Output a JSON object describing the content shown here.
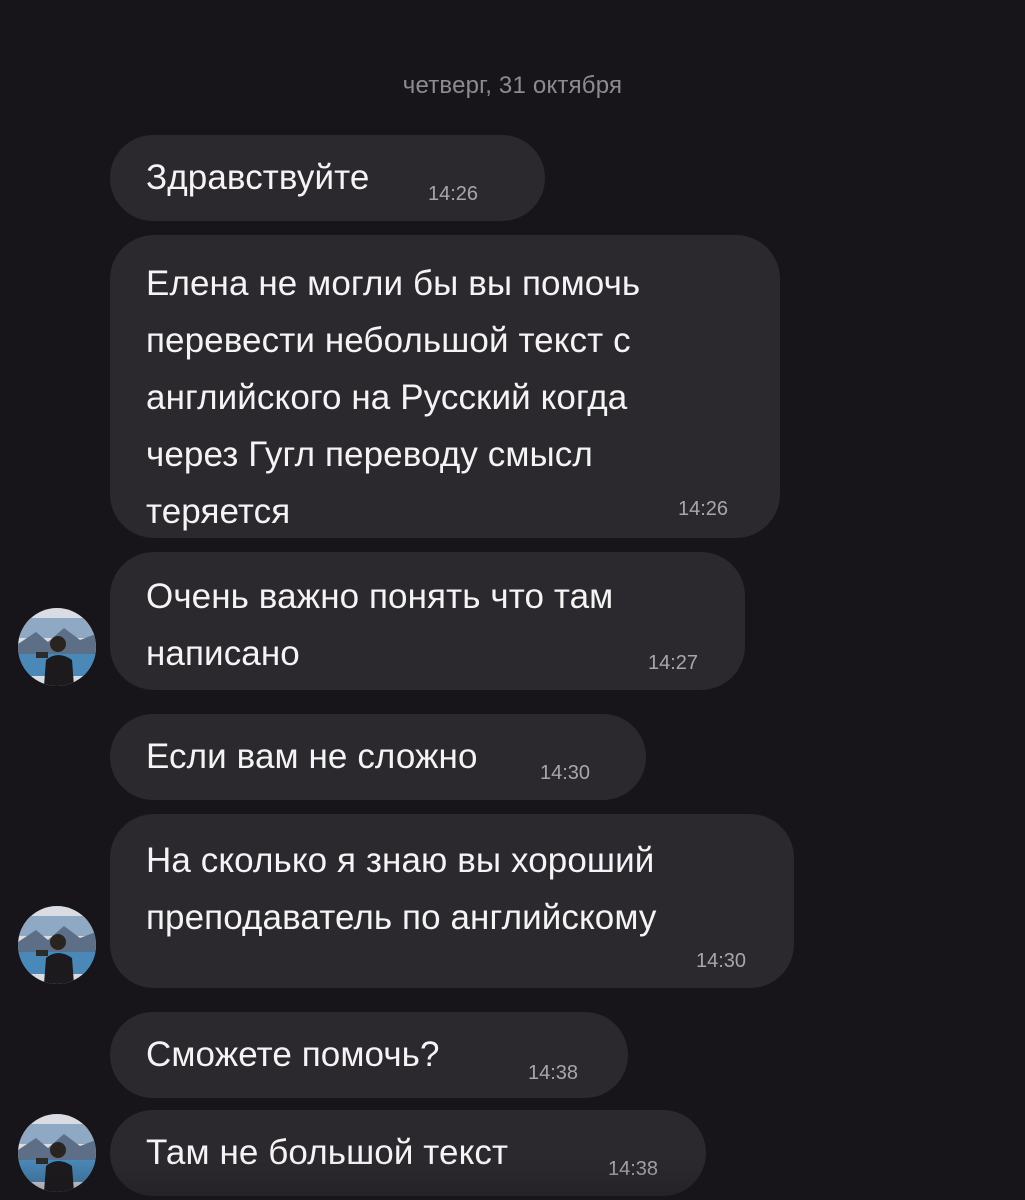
{
  "chat": {
    "date_separator": "четверг, 31 октября",
    "messages": [
      {
        "text": "Здравствуйте",
        "time": "14:26"
      },
      {
        "text": "Елена не могли бы вы помочь\nперевести небольшой текст с\nанглийского на Русский когда\nчерез Гугл переводу смысл\nтеряется",
        "time": "14:26"
      },
      {
        "text": "Очень важно понять что там\nнаписано",
        "time": "14:27"
      },
      {
        "text": "Если вам не сложно",
        "time": "14:30"
      },
      {
        "text": "На сколько я знаю вы хороший\nпреподаватель по английскому",
        "time": "14:30"
      },
      {
        "text": "Сможете помочь?",
        "time": "14:38"
      },
      {
        "text": "Там не большой текст",
        "time": "14:38"
      }
    ]
  },
  "colors": {
    "background": "#17151a",
    "bubble": "#2b292e",
    "text": "#f4f4f4",
    "meta_text": "#a8a6ab"
  },
  "icons": {
    "avatar": "sender-avatar-photo"
  }
}
